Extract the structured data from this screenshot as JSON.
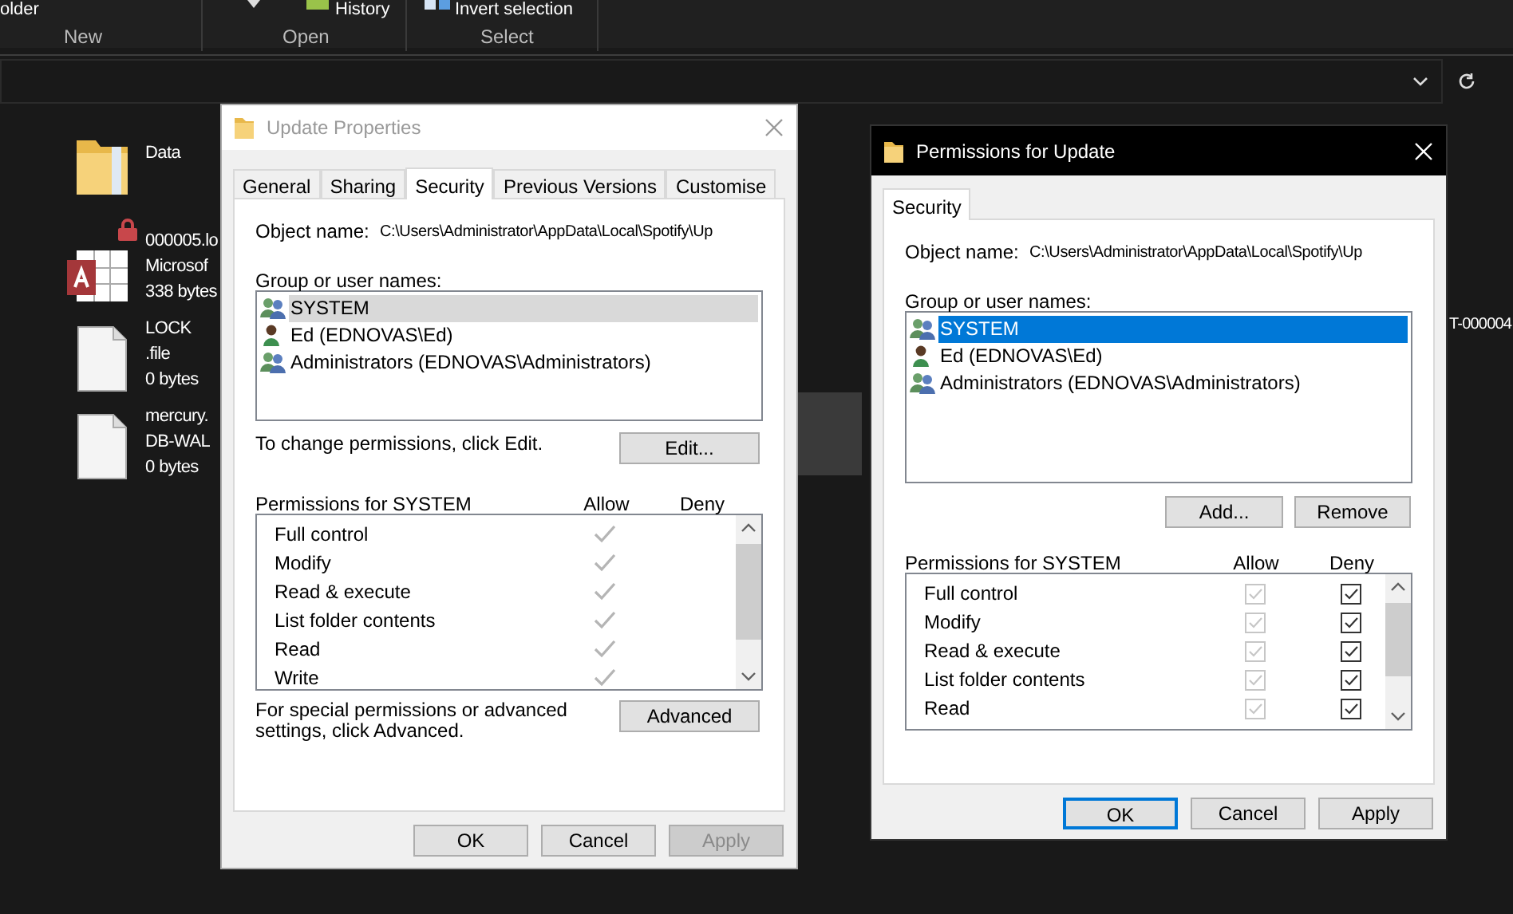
{
  "explorer": {
    "ribbon": {
      "cut_labels": [
        "older",
        "History",
        "Invert selection"
      ],
      "groups": [
        "New",
        "Open",
        "Select"
      ]
    },
    "files": [
      {
        "kind": "folder",
        "lines": [
          "Data"
        ]
      },
      {
        "kind": "database",
        "locked": true,
        "lines": [
          "000005.lo",
          "Microsof",
          "338 bytes"
        ]
      },
      {
        "kind": "file",
        "locked": false,
        "lines": [
          "LOCK",
          ".file",
          "0 bytes"
        ]
      },
      {
        "kind": "file",
        "locked": false,
        "lines": [
          "mercury.",
          "DB-WAL",
          "0 bytes"
        ]
      }
    ],
    "cut_file_name": "T-000004"
  },
  "properties_dialog": {
    "title": "Update Properties",
    "active": false,
    "tabs": [
      {
        "label": "General",
        "selected": false
      },
      {
        "label": "Sharing",
        "selected": false
      },
      {
        "label": "Security",
        "selected": true
      },
      {
        "label": "Previous Versions",
        "selected": false
      },
      {
        "label": "Customise",
        "selected": false
      }
    ],
    "object_name_label": "Object name:",
    "object_name": "C:\\Users\\Administrator\\AppData\\Local\\Spotify\\Up",
    "group_label": "Group or user names:",
    "principals": [
      {
        "name": "SYSTEM",
        "kind": "group",
        "selected": true
      },
      {
        "name": "Ed (EDNOVAS\\Ed)",
        "kind": "user",
        "selected": false
      },
      {
        "name": "Administrators (EDNOVAS\\Administrators)",
        "kind": "group",
        "selected": false
      }
    ],
    "change_hint": "To change permissions, click Edit.",
    "edit_button": "Edit...",
    "permissions_label": "Permissions for SYSTEM",
    "allow_header": "Allow",
    "deny_header": "Deny",
    "permissions": [
      {
        "kind": "tick",
        "name": "Full control",
        "allow": true,
        "deny": false
      },
      {
        "kind": "tick",
        "name": "Modify",
        "allow": true,
        "deny": false
      },
      {
        "kind": "tick",
        "name": "Read & execute",
        "allow": true,
        "deny": false
      },
      {
        "kind": "tick",
        "name": "List folder contents",
        "allow": true,
        "deny": false
      },
      {
        "kind": "tick",
        "name": "Read",
        "allow": true,
        "deny": false
      },
      {
        "kind": "tick",
        "name": "Write",
        "allow": true,
        "deny": false
      }
    ],
    "advanced_hint": "For special permissions or advanced settings, click Advanced.",
    "advanced_button": "Advanced",
    "buttons": [
      {
        "label": "OK",
        "default": false,
        "disabled": false
      },
      {
        "label": "Cancel",
        "default": false,
        "disabled": false
      },
      {
        "label": "Apply",
        "default": false,
        "disabled": true
      }
    ]
  },
  "permissions_dialog": {
    "title": "Permissions for Update",
    "active": true,
    "tabs": [
      {
        "label": "Security",
        "selected": true
      }
    ],
    "object_name_label": "Object name:",
    "object_name": "C:\\Users\\Administrator\\AppData\\Local\\Spotify\\Up",
    "group_label": "Group or user names:",
    "principals": [
      {
        "name": "SYSTEM",
        "kind": "group",
        "selected": true
      },
      {
        "name": "Ed (EDNOVAS\\Ed)",
        "kind": "user",
        "selected": false
      },
      {
        "name": "Administrators (EDNOVAS\\Administrators)",
        "kind": "group",
        "selected": false
      }
    ],
    "add_button": "Add...",
    "remove_button": "Remove",
    "permissions_label": "Permissions for SYSTEM",
    "allow_header": "Allow",
    "deny_header": "Deny",
    "allow_disabled": true,
    "permissions": [
      {
        "kind": "checkbox",
        "name": "Full control",
        "allow": true,
        "deny": true
      },
      {
        "kind": "checkbox",
        "name": "Modify",
        "allow": true,
        "deny": true
      },
      {
        "kind": "checkbox",
        "name": "Read & execute",
        "allow": true,
        "deny": true
      },
      {
        "kind": "checkbox",
        "name": "List folder contents",
        "allow": true,
        "deny": true
      },
      {
        "kind": "checkbox",
        "name": "Read",
        "allow": true,
        "deny": true
      }
    ],
    "buttons": [
      {
        "label": "OK",
        "default": true,
        "disabled": false
      },
      {
        "label": "Cancel",
        "default": false,
        "disabled": false
      },
      {
        "label": "Apply",
        "default": false,
        "disabled": false
      }
    ]
  }
}
